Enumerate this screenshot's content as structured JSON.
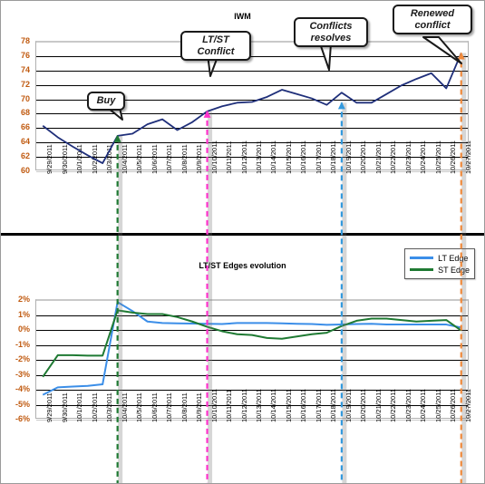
{
  "chart_data": [
    {
      "type": "line",
      "title": "IWM",
      "xlabel": "",
      "ylabel": "",
      "ylim": [
        60,
        78
      ],
      "yticks": [
        78,
        76,
        74,
        72,
        70,
        68,
        66,
        64,
        62,
        60
      ],
      "grid": true,
      "legend": "none",
      "line_color": "#1f2f7a",
      "categories": [
        "9/29/2011",
        "9/30/2011",
        "10/1/2011",
        "10/2/2011",
        "10/3/2011",
        "10/4/2011",
        "10/5/2011",
        "10/6/2011",
        "10/7/2011",
        "10/8/2011",
        "10/9/2011",
        "10/10/2011",
        "10/11/2011",
        "10/12/2011",
        "10/13/2011",
        "10/14/2011",
        "10/15/2011",
        "10/16/2011",
        "10/17/2011",
        "10/18/2011",
        "10/19/2011",
        "10/20/2011",
        "10/21/2011",
        "10/22/2011",
        "10/23/2011",
        "10/24/2011",
        "10/25/2011",
        "10/26/2011",
        "10/27/2011"
      ],
      "series": [
        {
          "name": "IWM",
          "values": [
            66.2,
            64.6,
            63.3,
            62.1,
            61.0,
            64.8,
            65.1,
            66.4,
            67.1,
            65.6,
            66.7,
            68.2,
            68.9,
            69.4,
            69.5,
            70.2,
            71.2,
            70.6,
            70.0,
            69.1,
            70.8,
            69.4,
            69.4,
            70.6,
            71.8,
            72.7,
            73.5,
            71.4,
            76.3
          ]
        }
      ],
      "annotations": [
        {
          "label": "Buy",
          "x": "10/4/2011",
          "y": 64.8,
          "marker_color": "#1f7a33"
        },
        {
          "label": "LT/ST\nConflict",
          "x": "10/10/2011",
          "y": 68.2,
          "marker_color": "#ff33cc"
        },
        {
          "label": "Conflicts\nresolves",
          "x": "10/19/2011",
          "y": 69.4,
          "marker_color": "#3399dd"
        },
        {
          "label": "Renewed\nconflict",
          "x": "10/27/2011",
          "y": 76.3,
          "marker_color": "#f08a3c"
        }
      ]
    },
    {
      "type": "line",
      "title": "LT/ST Edges evolution",
      "xlabel": "",
      "ylabel": "",
      "ylim": [
        -6,
        2
      ],
      "yticks": [
        "2%",
        "1%",
        "0%",
        "-1%",
        "-2%",
        "-3%",
        "-4%",
        "-5%",
        "-6%"
      ],
      "grid": true,
      "legend": "top-right",
      "categories": [
        "9/29/2011",
        "9/30/2011",
        "10/1/2011",
        "10/2/2011",
        "10/3/2011",
        "10/4/2011",
        "10/5/2011",
        "10/6/2011",
        "10/7/2011",
        "10/8/2011",
        "10/9/2011",
        "10/10/2011",
        "10/11/2011",
        "10/12/2011",
        "10/13/2011",
        "10/14/2011",
        "10/15/2011",
        "10/16/2011",
        "10/17/2011",
        "10/18/2011",
        "10/19/2011",
        "10/20/2011",
        "10/21/2011",
        "10/22/2011",
        "10/23/2011",
        "10/24/2011",
        "10/25/2011",
        "10/26/2011",
        "10/27/2011"
      ],
      "series": [
        {
          "name": "LT Edge",
          "color": "#3b8ee8",
          "values": [
            -4.4,
            -3.9,
            -3.85,
            -3.8,
            -3.7,
            1.8,
            1.2,
            0.5,
            0.4,
            0.38,
            0.36,
            0.35,
            0.33,
            0.4,
            0.4,
            0.4,
            0.38,
            0.35,
            0.33,
            0.28,
            0.3,
            0.33,
            0.35,
            0.3,
            0.3,
            0.3,
            0.3,
            0.3,
            0.1
          ]
        },
        {
          "name": "ST Edge",
          "color": "#1f7a33",
          "values": [
            -3.2,
            -1.75,
            -1.75,
            -1.78,
            -1.78,
            1.25,
            1.1,
            1.0,
            1.0,
            0.8,
            0.5,
            0.15,
            -0.15,
            -0.35,
            -0.4,
            -0.6,
            -0.65,
            -0.5,
            -0.35,
            -0.25,
            0.2,
            0.55,
            0.7,
            0.7,
            0.6,
            0.5,
            0.55,
            0.6,
            -0.1
          ]
        }
      ],
      "annotations": [
        {
          "label": "Buy",
          "x": "10/4/2011",
          "marker_color": "#1f7a33"
        },
        {
          "label": "LT/ST Conflict",
          "x": "10/10/2011",
          "marker_color": "#ff33cc"
        },
        {
          "label": "Conflicts resolves",
          "x": "10/19/2011",
          "marker_color": "#3399dd"
        },
        {
          "label": "Renewed conflict",
          "x": "10/27/2011",
          "marker_color": "#f08a3c"
        }
      ]
    }
  ],
  "top_chart": {
    "title": "IWM",
    "yticks": [
      "78",
      "76",
      "74",
      "72",
      "70",
      "68",
      "66",
      "64",
      "62",
      "60"
    ],
    "callouts": {
      "buy": "Buy",
      "ltst_conflict_line1": "LT/ST",
      "ltst_conflict_line2": "Conflict",
      "conflicts_resolves_line1": "Conflicts",
      "conflicts_resolves_line2": "resolves",
      "renewed_conflict_line1": "Renewed",
      "renewed_conflict_line2": "conflict"
    },
    "xticks": [
      "9/29/2011",
      "9/30/2011",
      "10/1/2011",
      "10/2/2011",
      "10/3/2011",
      "10/4/2011",
      "10/5/2011",
      "10/6/2011",
      "10/7/2011",
      "10/8/2011",
      "10/9/2011",
      "10/10/2011",
      "10/11/2011",
      "10/12/2011",
      "10/13/2011",
      "10/14/2011",
      "10/15/2011",
      "10/16/2011",
      "10/17/2011",
      "10/18/2011",
      "10/19/2011",
      "10/20/2011",
      "10/21/2011",
      "10/22/2011",
      "10/23/2011",
      "10/24/2011",
      "10/25/2011",
      "10/26/2011",
      "10/27/2011"
    ]
  },
  "bottom_chart": {
    "title": "LT/ST Edges evolution",
    "yticks": [
      "2%",
      "1%",
      "0%",
      "-1%",
      "-2%",
      "-3%",
      "-4%",
      "-5%",
      "-6%"
    ],
    "legend": [
      {
        "label": "LT Edge",
        "color": "#3b8ee8"
      },
      {
        "label": "ST Edge",
        "color": "#1f7a33"
      }
    ],
    "xticks": [
      "9/29/2011",
      "9/30/2011",
      "10/1/2011",
      "10/2/2011",
      "10/3/2011",
      "10/4/2011",
      "10/5/2011",
      "10/6/2011",
      "10/7/2011",
      "10/8/2011",
      "10/9/2011",
      "10/10/2011",
      "10/11/2011",
      "10/12/2011",
      "10/13/2011",
      "10/14/2011",
      "10/15/2011",
      "10/16/2011",
      "10/17/2011",
      "10/18/2011",
      "10/19/2011",
      "10/20/2011",
      "10/21/2011",
      "10/22/2011",
      "10/23/2011",
      "10/24/2011",
      "10/25/2011",
      "10/26/2011",
      "10/27/2011"
    ]
  },
  "markers": {
    "buy_color": "#1f7a33",
    "conflict_color": "#ff33cc",
    "resolve_color": "#3399dd",
    "renewed_color": "#f08a3c"
  }
}
